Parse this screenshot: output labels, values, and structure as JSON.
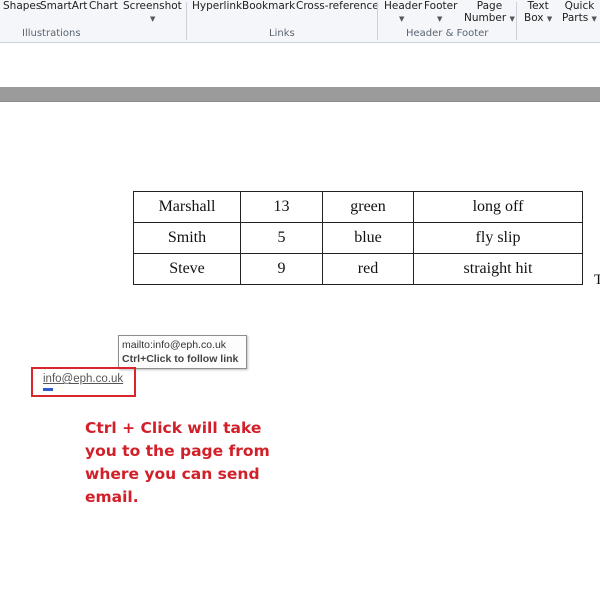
{
  "ribbon": {
    "illustrations": {
      "shapes": "Shapes",
      "smartart": "SmartArt",
      "chart": "Chart",
      "screenshot": "Screenshot",
      "group_label": "Illustrations"
    },
    "links": {
      "hyperlink": "Hyperlink",
      "bookmark": "Bookmark",
      "cross_reference": "Cross-reference",
      "group_label": "Links"
    },
    "header_footer": {
      "header": "Header",
      "footer": "Footer",
      "page_number_1": "Page",
      "page_number_2": "Number",
      "group_label": "Header & Footer"
    },
    "text": {
      "text_box_1": "Text",
      "text_box_2": "Box",
      "quick_parts_1": "Quick",
      "quick_parts_2": "Parts"
    },
    "dropdown_glyph": "▼"
  },
  "table": {
    "rows": [
      [
        "Marshall",
        "13",
        "green",
        "long off"
      ],
      [
        "Smith",
        "5",
        "blue",
        "fly slip"
      ],
      [
        "Steve",
        "9",
        "red",
        "straight hit"
      ]
    ]
  },
  "cursor_text": "T",
  "tooltip": {
    "line1": "mailto:info@eph.co.uk",
    "line2": "Ctrl+Click to follow link"
  },
  "hyperlink_text": "info@eph.co.uk",
  "annotation": {
    "line1": "Ctrl + Click will take",
    "line2": "you to the page from",
    "line3": "where you can send",
    "line4": "email."
  },
  "colors": {
    "annotation": "#d2202a",
    "highlight_box": "#d9262a",
    "smart_tag": "#2f5cc9"
  }
}
